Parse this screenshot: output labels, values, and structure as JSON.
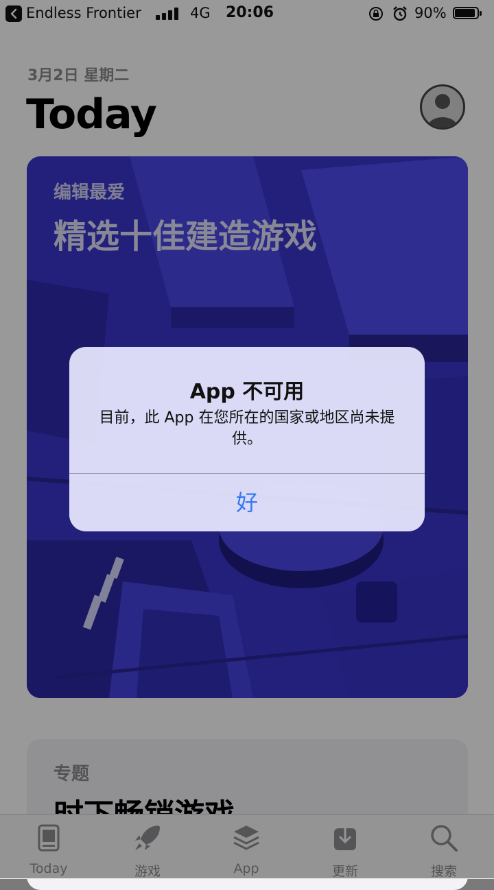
{
  "status_bar": {
    "back_app": "Endless Frontier",
    "network": "4G",
    "time": "20:06",
    "battery_percent": "90%",
    "battery_level": 0.9
  },
  "header": {
    "date": "3月2日 星期二",
    "title": "Today"
  },
  "featured_card": {
    "eyebrow": "编辑最爱",
    "title": "精选十佳建造游戏",
    "color": "#3d37d6"
  },
  "second_card": {
    "eyebrow": "专题",
    "title": "时下畅销游戏"
  },
  "tab_bar": {
    "tabs": [
      {
        "label": "Today",
        "icon": "today-icon"
      },
      {
        "label": "游戏",
        "icon": "rocket-icon"
      },
      {
        "label": "App",
        "icon": "layers-icon"
      },
      {
        "label": "更新",
        "icon": "download-icon"
      },
      {
        "label": "搜索",
        "icon": "search-icon"
      }
    ]
  },
  "alert": {
    "title": "App 不可用",
    "message": "目前，此 App 在您所在的国家或地区尚未提供。",
    "ok_label": "好",
    "ok_color": "#3478f6"
  }
}
